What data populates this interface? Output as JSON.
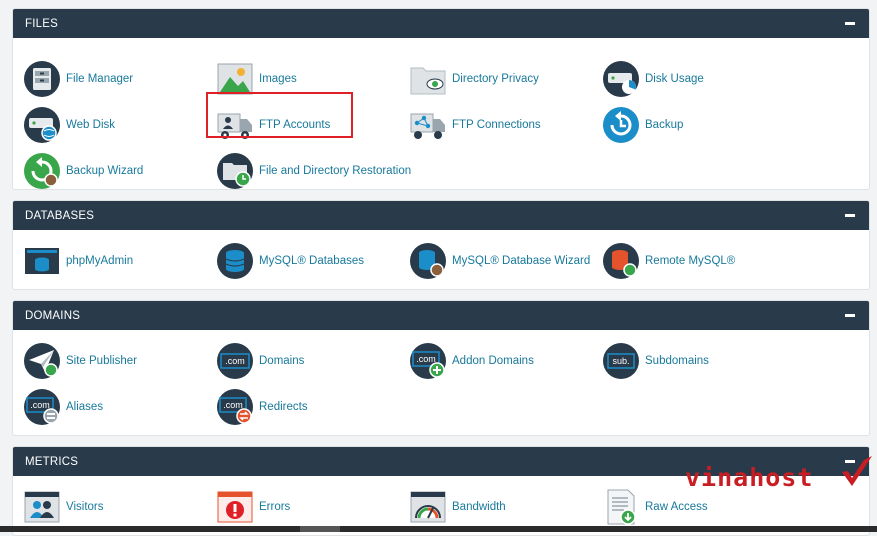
{
  "sections": {
    "files": {
      "title": "FILES",
      "items": {
        "file_manager": "File Manager",
        "images": "Images",
        "directory_privacy": "Directory Privacy",
        "disk_usage": "Disk Usage",
        "web_disk": "Web Disk",
        "ftp_accounts": "FTP Accounts",
        "ftp_connections": "FTP Connections",
        "backup": "Backup",
        "backup_wizard": "Backup Wizard",
        "file_restoration": "File and Directory Restoration"
      }
    },
    "databases": {
      "title": "DATABASES",
      "items": {
        "phpmyadmin": "phpMyAdmin",
        "mysql_databases": "MySQL® Databases",
        "mysql_wizard": "MySQL® Database Wizard",
        "remote_mysql": "Remote MySQL®"
      }
    },
    "domains": {
      "title": "DOMAINS",
      "items": {
        "site_publisher": "Site Publisher",
        "domains": "Domains",
        "addon_domains": "Addon Domains",
        "subdomains": "Subdomains",
        "aliases": "Aliases",
        "redirects": "Redirects"
      }
    },
    "metrics": {
      "title": "METRICS",
      "items": {
        "visitors": "Visitors",
        "errors": "Errors",
        "bandwidth": "Bandwidth",
        "raw_access": "Raw Access"
      }
    }
  },
  "icon_text": {
    "com": ".com",
    "sub": "sub."
  },
  "watermark": "vinahost",
  "colors": {
    "header_bg": "#293a4a",
    "link": "#18799b",
    "icon_dark": "#293a4a",
    "icon_blue": "#1b8ec9",
    "icon_green": "#3aa64c",
    "icon_orange": "#e4532c",
    "highlight": "#e02027",
    "brand": "#c81e23"
  }
}
